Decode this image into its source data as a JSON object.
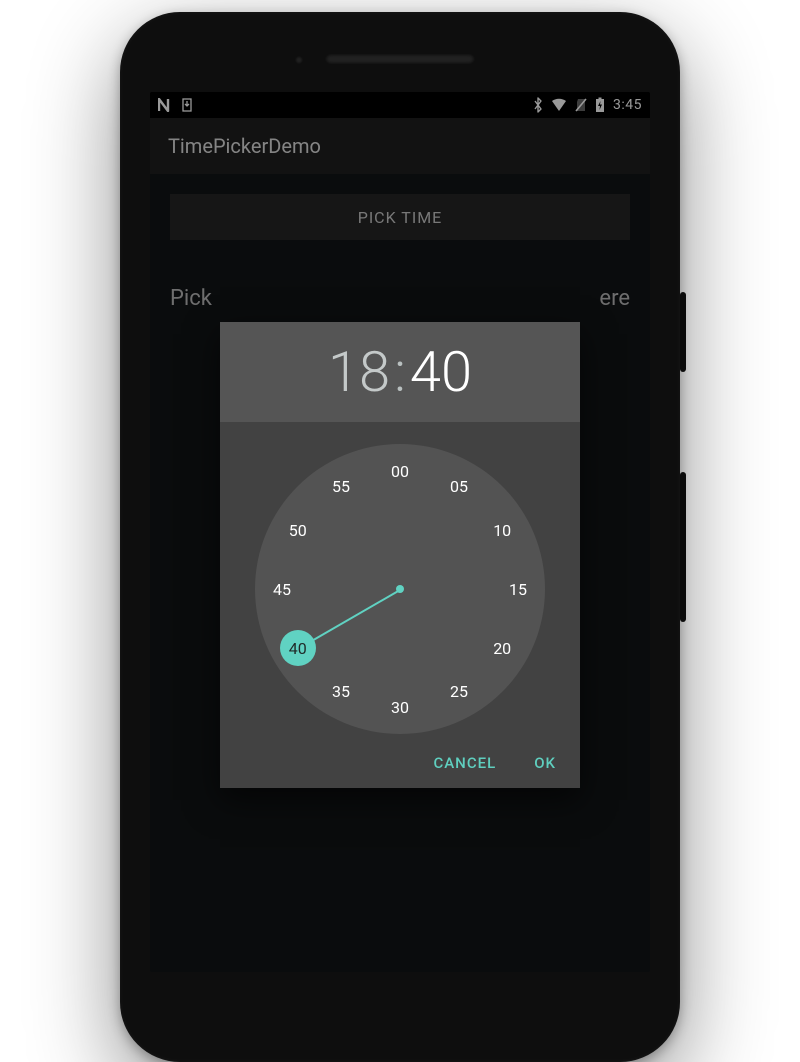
{
  "statusbar": {
    "time": "3:45"
  },
  "app": {
    "title": "TimePickerDemo",
    "pick_button": "PICK TIME",
    "hint_left": "Pick",
    "hint_right": "ere"
  },
  "dialog": {
    "hour": "18",
    "colon": ":",
    "minute": "40",
    "cancel": "CANCEL",
    "ok": "OK",
    "selected_minute": 40,
    "ticks": [
      "00",
      "05",
      "10",
      "15",
      "20",
      "25",
      "30",
      "35",
      "40",
      "45",
      "50",
      "55"
    ]
  },
  "colors": {
    "accent": "#5fcfbf",
    "accent_fill": "#60d2c2",
    "dialog_bg": "#424242",
    "header_bg": "#555555"
  }
}
